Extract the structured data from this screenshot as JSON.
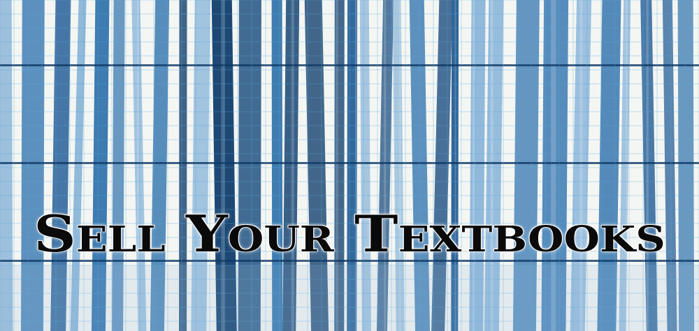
{
  "banner": {
    "headline": "Sell Your Textbooks",
    "image_description": "blue glass skyscraper facade"
  },
  "colors": {
    "sky": "#f4f6f3",
    "glass_dark": "#1d4e80",
    "glass_mid": "#3d7bb0",
    "glass_light": "#8fb8da",
    "frame": "#5aa6d8",
    "text": "#0a0a0a"
  }
}
